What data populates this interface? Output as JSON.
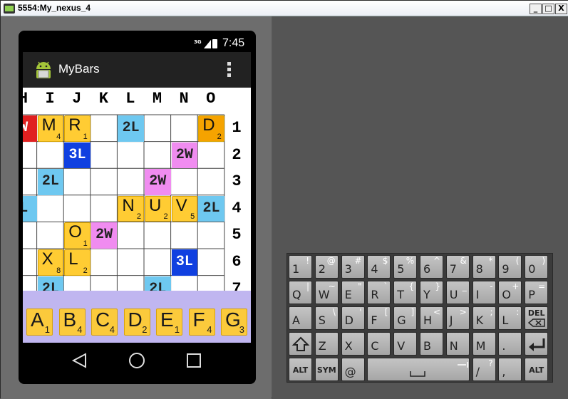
{
  "window": {
    "title": "5554:My_nexus_4",
    "buttons": [
      "_",
      "□",
      "X"
    ]
  },
  "status": {
    "network": "3G",
    "time": "7:45"
  },
  "app": {
    "title": "MyBars",
    "logo_icon": "android-icon",
    "menu_icon": "overflow-menu-icon"
  },
  "board": {
    "columns": [
      "H",
      "I",
      "J",
      "K",
      "L",
      "M",
      "N",
      "O"
    ],
    "rows": [
      "1",
      "2",
      "3",
      "4",
      "5",
      "6",
      "7"
    ],
    "colors": {
      "2W": "#f08cf0",
      "3W": "#e02020",
      "2L": "#6ec8f0",
      "3L": "#1040e0",
      "tile": "#ffcc33",
      "tile_dark": "#f5a300",
      "tray": "#c0b6f0"
    },
    "premium_cells": [
      {
        "row": 1,
        "col": "H",
        "label": "W",
        "type": "3W"
      },
      {
        "row": 1,
        "col": "L",
        "label": "2L",
        "type": "2L"
      },
      {
        "row": 2,
        "col": "J",
        "label": "3L",
        "type": "3L"
      },
      {
        "row": 2,
        "col": "N",
        "label": "2W",
        "type": "2W"
      },
      {
        "row": 3,
        "col": "I",
        "label": "2L",
        "type": "2L"
      },
      {
        "row": 3,
        "col": "M",
        "label": "2W",
        "type": "2W"
      },
      {
        "row": 4,
        "col": "H",
        "label": "L",
        "type": "2L"
      },
      {
        "row": 4,
        "col": "O",
        "label": "2L",
        "type": "2L"
      },
      {
        "row": 5,
        "col": "K",
        "label": "2W",
        "type": "2W"
      },
      {
        "row": 6,
        "col": "N",
        "label": "3L",
        "type": "3L"
      },
      {
        "row": 7,
        "col": "I",
        "label": "2L",
        "type": "2L"
      },
      {
        "row": 7,
        "col": "M",
        "label": "2L",
        "type": "2L"
      }
    ],
    "placed_tiles": [
      {
        "row": 1,
        "col": "I",
        "letter": "M",
        "points": "4"
      },
      {
        "row": 1,
        "col": "J",
        "letter": "R",
        "points": "1"
      },
      {
        "row": 1,
        "col": "O",
        "letter": "D",
        "points": "2",
        "style": "dark"
      },
      {
        "row": 4,
        "col": "L",
        "letter": "N",
        "points": "2"
      },
      {
        "row": 4,
        "col": "M",
        "letter": "U",
        "points": "2"
      },
      {
        "row": 4,
        "col": "N",
        "letter": "V",
        "points": "5"
      },
      {
        "row": 5,
        "col": "J",
        "letter": "O",
        "points": "1"
      },
      {
        "row": 6,
        "col": "I",
        "letter": "X",
        "points": "8"
      },
      {
        "row": 6,
        "col": "J",
        "letter": "L",
        "points": "2"
      }
    ]
  },
  "rack": [
    {
      "letter": "A",
      "points": "1"
    },
    {
      "letter": "B",
      "points": "4"
    },
    {
      "letter": "C",
      "points": "4"
    },
    {
      "letter": "D",
      "points": "2"
    },
    {
      "letter": "E",
      "points": "1"
    },
    {
      "letter": "F",
      "points": "4"
    },
    {
      "letter": "G",
      "points": "3"
    }
  ],
  "navbar": {
    "back_icon": "back-icon",
    "home_icon": "home-icon",
    "recents_icon": "recents-icon"
  },
  "keyboard": {
    "rows": [
      [
        {
          "m": "1",
          "s": "!"
        },
        {
          "m": "2",
          "s": "@"
        },
        {
          "m": "3",
          "s": "#"
        },
        {
          "m": "4",
          "s": "$"
        },
        {
          "m": "5",
          "s": "%"
        },
        {
          "m": "6",
          "s": "^"
        },
        {
          "m": "7",
          "s": "&"
        },
        {
          "m": "8",
          "s": "*"
        },
        {
          "m": "9",
          "s": "("
        },
        {
          "m": "0",
          "s": ")"
        }
      ],
      [
        {
          "m": "Q",
          "s": "|"
        },
        {
          "m": "W",
          "s": "~"
        },
        {
          "m": "E",
          "s": "\""
        },
        {
          "m": "R",
          "s": "`"
        },
        {
          "m": "T",
          "s": "{"
        },
        {
          "m": "Y",
          "s": "}"
        },
        {
          "m": "U",
          "s": "_"
        },
        {
          "m": "I",
          "s": "-"
        },
        {
          "m": "O",
          "s": "+"
        },
        {
          "m": "P",
          "s": "="
        }
      ],
      [
        {
          "m": "A",
          "s": ""
        },
        {
          "m": "S",
          "s": "\\"
        },
        {
          "m": "D",
          "s": "'"
        },
        {
          "m": "F",
          "s": "["
        },
        {
          "m": "G",
          "s": "]"
        },
        {
          "m": "H",
          "s": "<"
        },
        {
          "m": "J",
          "s": ">"
        },
        {
          "m": "K",
          "s": ";"
        },
        {
          "m": "L",
          "s": ":"
        },
        {
          "m": "DEL",
          "s": "",
          "special": "del"
        }
      ],
      [
        {
          "m": "",
          "s": "",
          "special": "shift"
        },
        {
          "m": "Z",
          "s": ""
        },
        {
          "m": "X",
          "s": ""
        },
        {
          "m": "C",
          "s": ""
        },
        {
          "m": "V",
          "s": ""
        },
        {
          "m": "B",
          "s": ""
        },
        {
          "m": "N",
          "s": ""
        },
        {
          "m": "M",
          "s": ""
        },
        {
          "m": ".",
          "s": ""
        },
        {
          "m": "",
          "s": "",
          "special": "enter"
        }
      ],
      [
        {
          "m": "ALT",
          "s": "",
          "special": "alt"
        },
        {
          "m": "SYM",
          "s": "",
          "special": "sym"
        },
        {
          "m": "@",
          "s": ""
        },
        {
          "m": "",
          "s": "",
          "special": "space"
        },
        {
          "m": "/",
          "s": "?"
        },
        {
          "m": ",",
          "s": ""
        },
        {
          "m": "ALT",
          "s": "",
          "special": "alt"
        }
      ]
    ]
  }
}
